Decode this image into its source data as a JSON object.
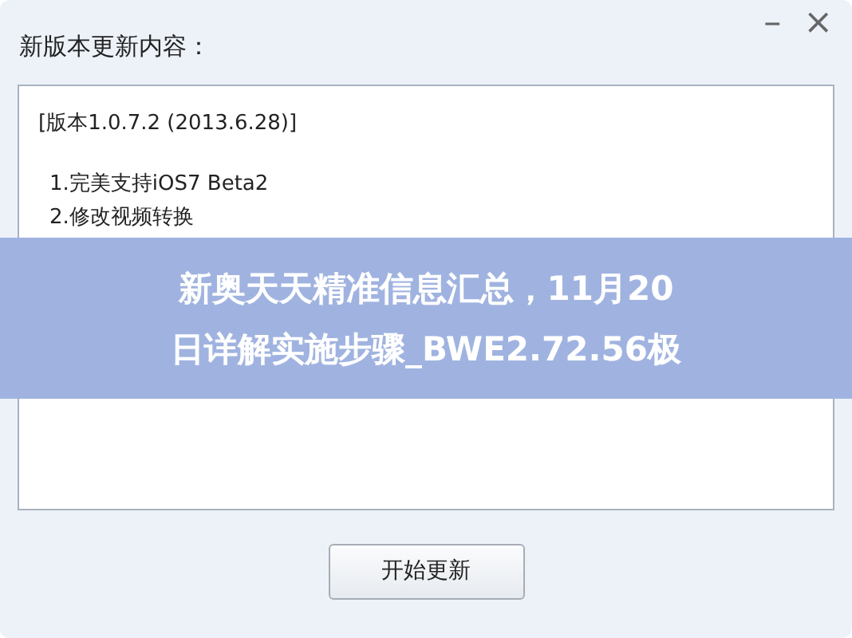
{
  "window": {
    "title": "新版本更新内容：",
    "controls": [
      "–",
      "×"
    ]
  },
  "notes": {
    "heading": "[版本1.0.7.2 (2013.6.28)]",
    "items": [
      "1.完美支持iOS7 Beta2",
      "2.修改视频转换"
    ]
  },
  "banner": {
    "lines": [
      "新奥天天精准信息汇总，11月20",
      "日详解实施步骤_BWE2.72.56极"
    ]
  },
  "buttons": [
    "开始更新"
  ]
}
